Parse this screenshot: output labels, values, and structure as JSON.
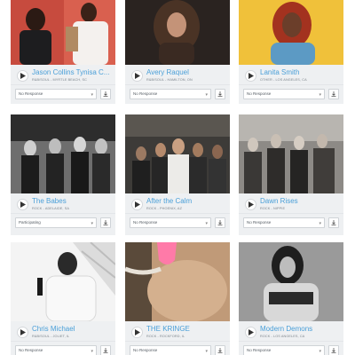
{
  "cards": [
    {
      "name": "Jason Collins Tynisa C...",
      "meta": "R&B/SOUL - MYRTLE BEACH, SC",
      "response": "No Response",
      "photo": "couple-red-backdrop"
    },
    {
      "name": "Avery Raquel",
      "meta": "R&B/SOUL - HAMILTON, ON",
      "response": "No Response",
      "photo": "singer-curly-hair"
    },
    {
      "name": "Lanita Smith",
      "meta": "OTHER - LOS ANGELES, CA",
      "response": "No Response",
      "photo": "woman-red-locs"
    },
    {
      "name": "The Babes",
      "meta": "ROCK - ADELAIDE, SA",
      "response": "Participating",
      "photo": "band-bw-four"
    },
    {
      "name": "After the Calm",
      "meta": "ROCK - PHOENIX, AZ",
      "response": "No Response",
      "photo": "band-five-men"
    },
    {
      "name": "Dawn Rises",
      "meta": "ROCK - NIPPIE",
      "response": "No Response",
      "photo": "band-outdoor"
    },
    {
      "name": "Chris Michael",
      "meta": "R&B/SOUL - JOLIET, IL",
      "response": "No Response",
      "photo": "man-microphone"
    },
    {
      "name": "THE KRINGE",
      "meta": "ROCK - ROCKFORD, IL",
      "response": "No Response",
      "photo": "pink-pick-closeup"
    },
    {
      "name": "Modern Demons",
      "meta": "ROCK - LOS ANGELES, CA",
      "response": "No Response",
      "photo": "woman-bw-portrait"
    }
  ],
  "icons": {
    "play": "play-icon",
    "download": "download-icon",
    "dropdown": "chevron-down-icon"
  },
  "colors": {
    "name": "#4a9fd8",
    "panel": "#eef0f2"
  }
}
